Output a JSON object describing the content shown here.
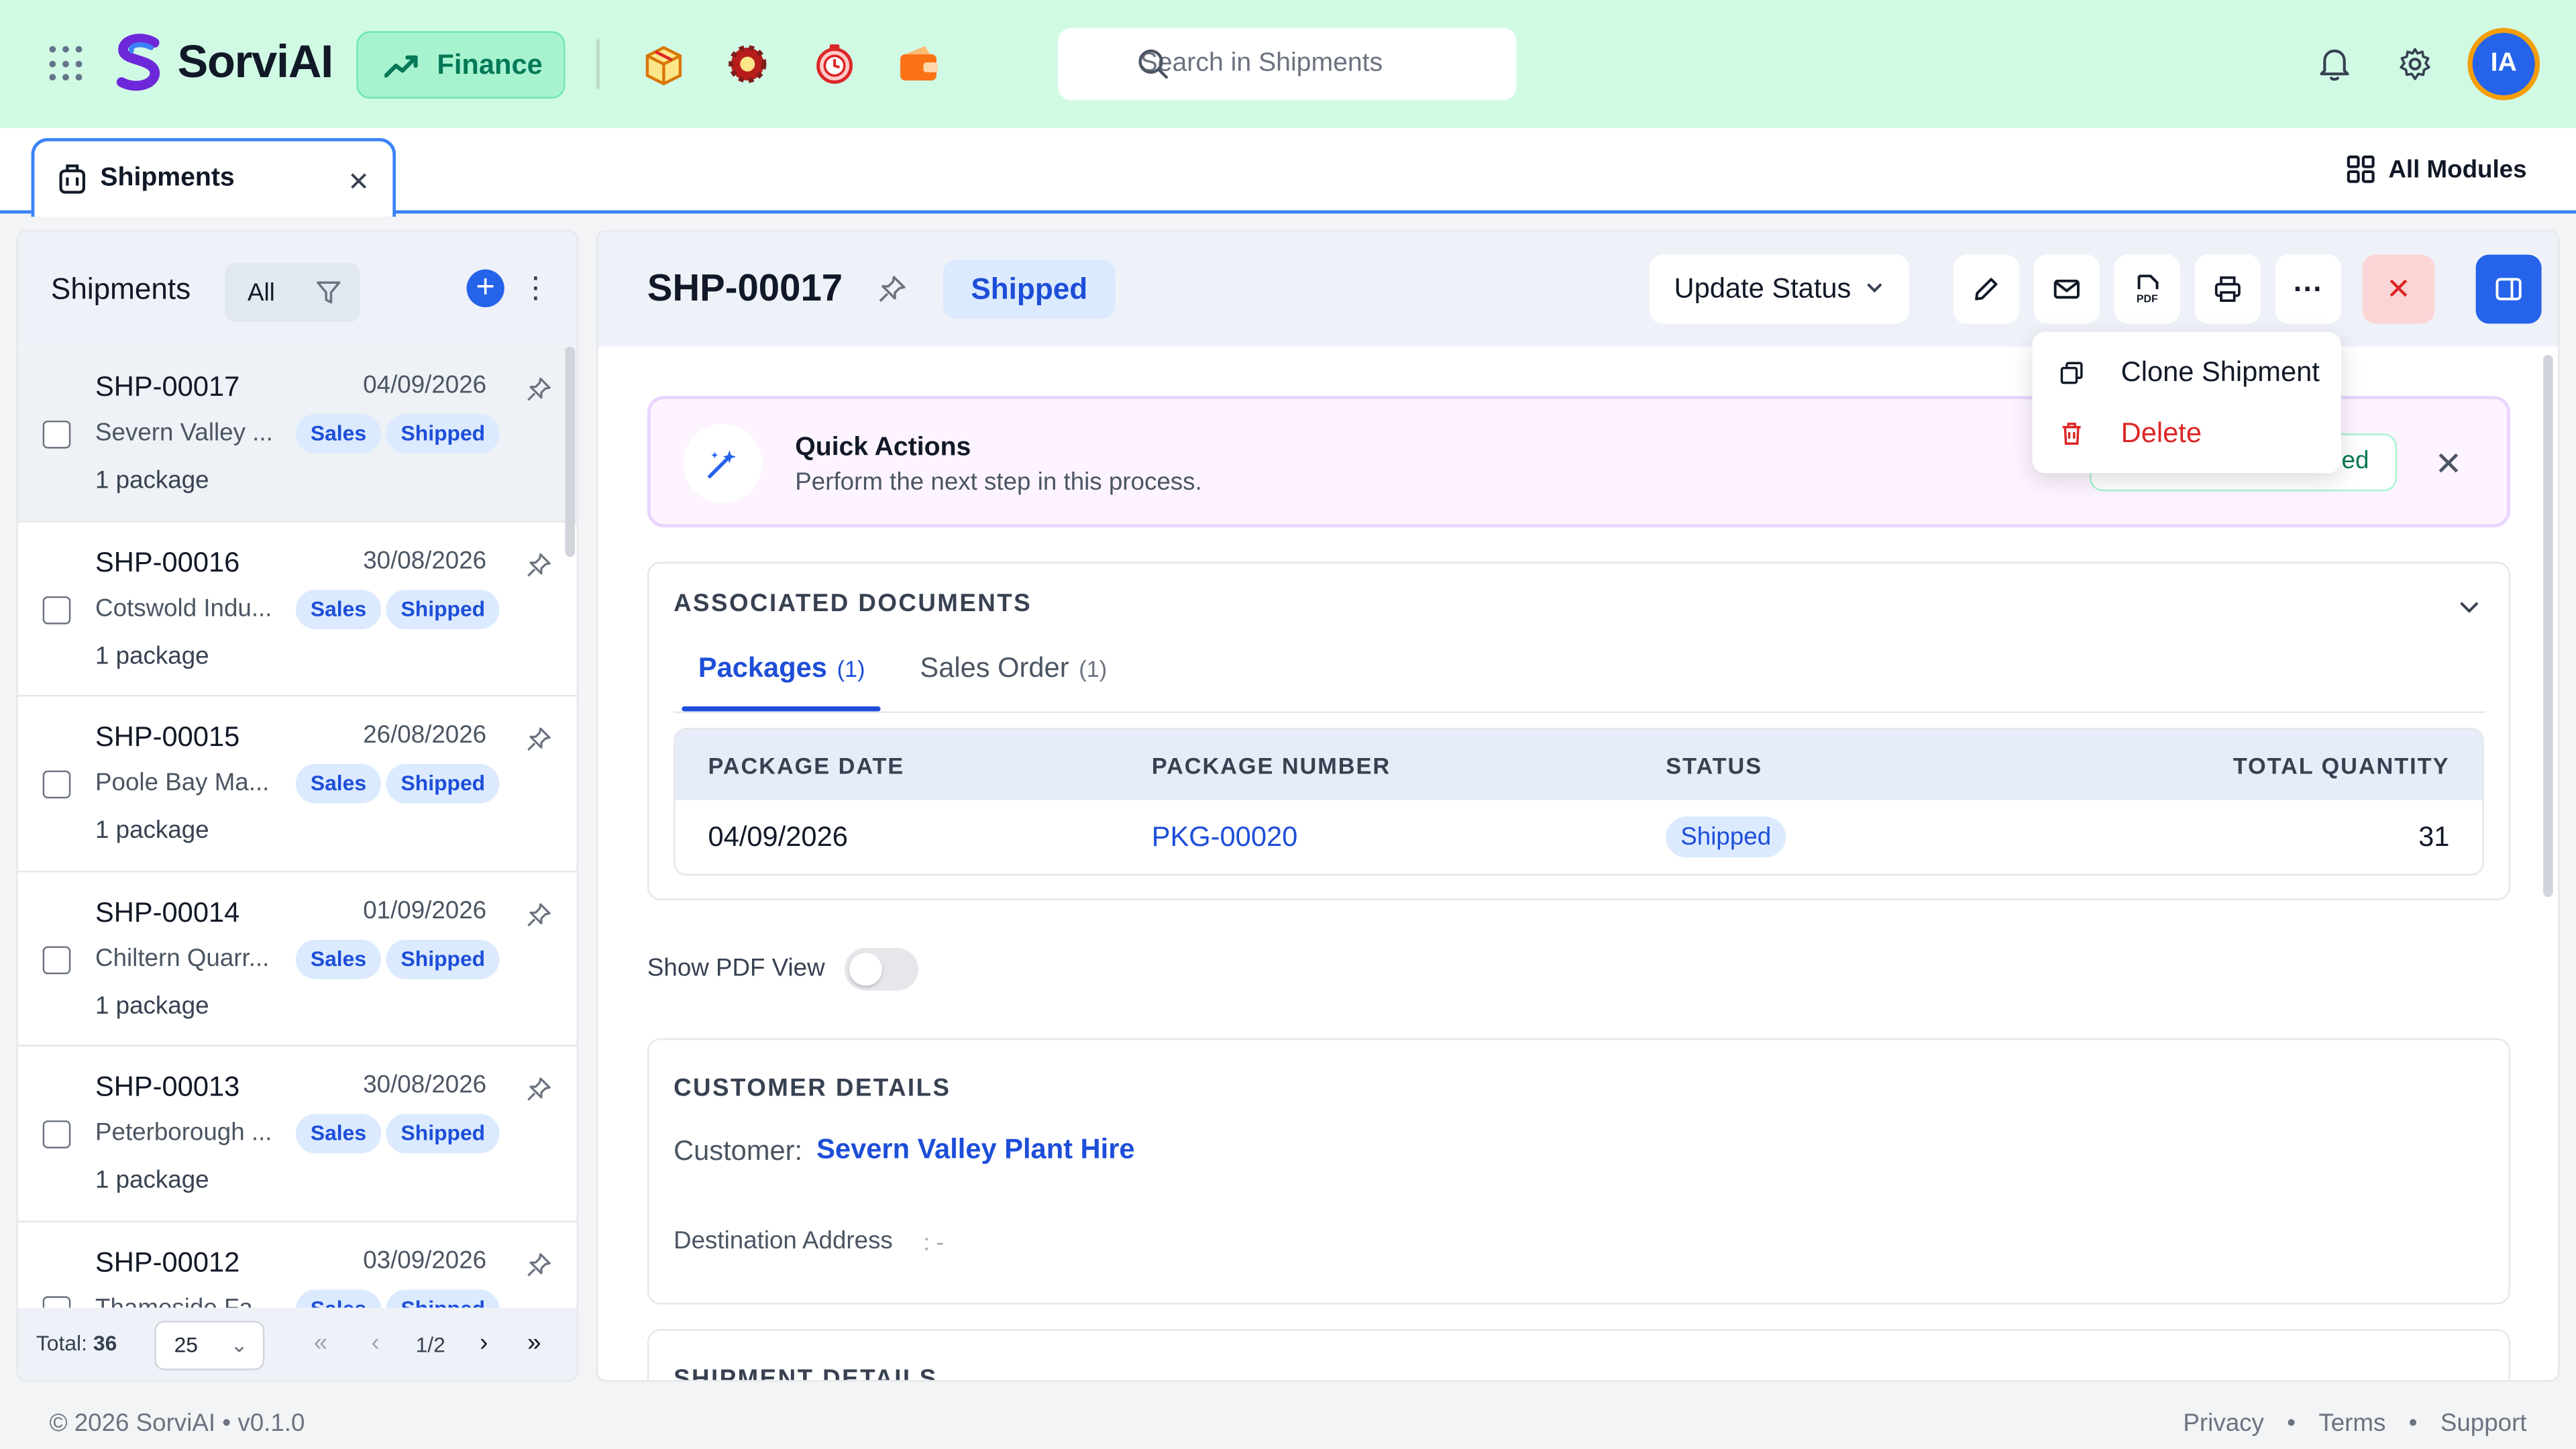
{
  "app": {
    "name": "SorviAI",
    "module": "Finance",
    "search_placeholder": "Search in Shipments",
    "user_initials": "IA",
    "colors": {
      "accent": "#2563eb",
      "header_bg": "#d1fae5",
      "danger": "#dc2626"
    }
  },
  "tabs": {
    "active": "Shipments",
    "all_modules": "All Modules"
  },
  "list": {
    "title": "Shipments",
    "filter_label": "All",
    "items": [
      {
        "id": "SHP-00017",
        "date": "04/09/2026",
        "customer": "Severn Valley ...",
        "type": "Sales",
        "status": "Shipped",
        "packages": "1 package"
      },
      {
        "id": "SHP-00016",
        "date": "30/08/2026",
        "customer": "Cotswold Indu...",
        "type": "Sales",
        "status": "Shipped",
        "packages": "1 package"
      },
      {
        "id": "SHP-00015",
        "date": "26/08/2026",
        "customer": "Poole Bay Ma...",
        "type": "Sales",
        "status": "Shipped",
        "packages": "1 package"
      },
      {
        "id": "SHP-00014",
        "date": "01/09/2026",
        "customer": "Chiltern Quarr...",
        "type": "Sales",
        "status": "Shipped",
        "packages": "1 package"
      },
      {
        "id": "SHP-00013",
        "date": "30/08/2026",
        "customer": "Peterborough ...",
        "type": "Sales",
        "status": "Shipped",
        "packages": "1 package"
      },
      {
        "id": "SHP-00012",
        "date": "03/09/2026",
        "customer": "Thameside Fa...",
        "type": "Sales",
        "status": "Shipped",
        "packages": ""
      }
    ],
    "footer": {
      "total_label": "Total:",
      "total": "36",
      "page_size": "25",
      "page": "1/2"
    }
  },
  "detail": {
    "id": "SHP-00017",
    "status": "Shipped",
    "update_status": "Update Status",
    "menu": {
      "clone": "Clone Shipment",
      "delete": "Delete"
    },
    "quick_actions": {
      "title": "Quick Actions",
      "subtitle": "Perform the next step in this process.",
      "button_tail": "ed"
    },
    "associated": {
      "title": "ASSOCIATED DOCUMENTS",
      "tabs": [
        {
          "label": "Packages",
          "count": "(1)"
        },
        {
          "label": "Sales Order",
          "count": "(1)"
        }
      ],
      "columns": [
        "PACKAGE DATE",
        "PACKAGE NUMBER",
        "STATUS",
        "TOTAL QUANTITY"
      ],
      "rows": [
        {
          "date": "04/09/2026",
          "number": "PKG-00020",
          "status": "Shipped",
          "qty": "31"
        }
      ]
    },
    "pdf_view_label": "Show PDF View",
    "pdf_view_on": false,
    "customer": {
      "title": "CUSTOMER DETAILS",
      "label": "Customer:",
      "value": "Severn Valley Plant Hire",
      "dest_label": "Destination Address",
      "dest_value": ": -"
    },
    "shipment_title": "SHIPMENT DETAILS"
  },
  "footer": {
    "copyright": "© 2026 SorviAI",
    "version": "v0.1.0",
    "links": [
      "Privacy",
      "Terms",
      "Support"
    ]
  }
}
